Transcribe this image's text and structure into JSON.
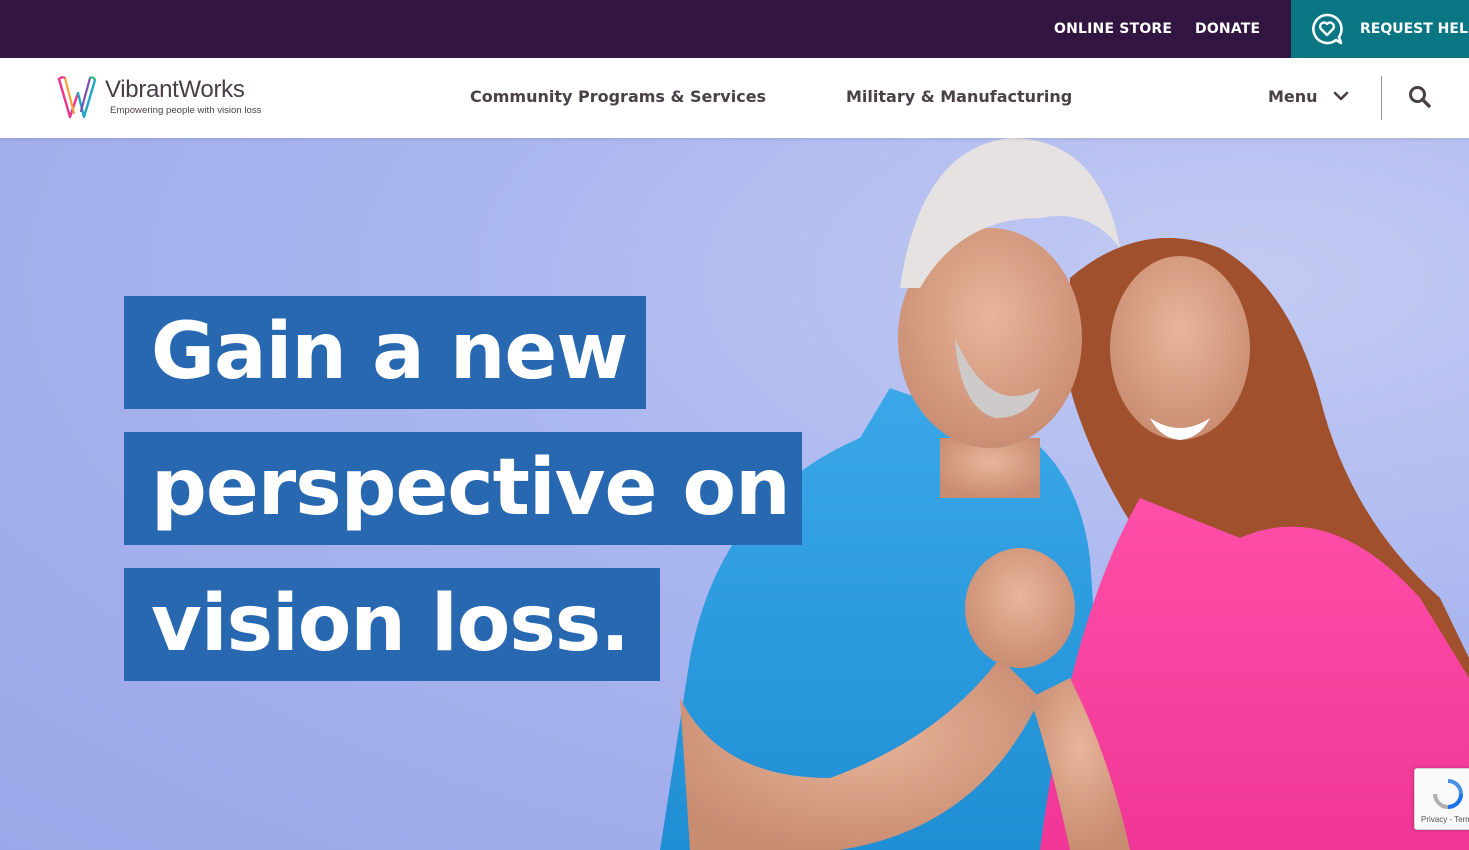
{
  "topbar": {
    "online_store": "ONLINE STORE",
    "donate": "DONATE",
    "request_help": "REQUEST HELP"
  },
  "logo": {
    "name_a": "Vibrant",
    "name_b": "Works",
    "tagline": "Empowering people with vision loss"
  },
  "nav": {
    "community": "Community Programs & Services",
    "military": "Military & Manufacturing",
    "menu": "Menu"
  },
  "hero": {
    "line1": "Gain a new",
    "line2": "perspective on",
    "line3": "vision loss."
  },
  "recaptcha": {
    "text": "Privacy - Terms"
  },
  "colors": {
    "topbar": "#321540",
    "request_help": "#0a7684",
    "headline_bg": "#2868b1",
    "hero_bg": "#aab6ef"
  },
  "icons": {
    "request_help": "heart-chat-icon",
    "menu": "chevron-down-icon",
    "search": "search-icon"
  }
}
